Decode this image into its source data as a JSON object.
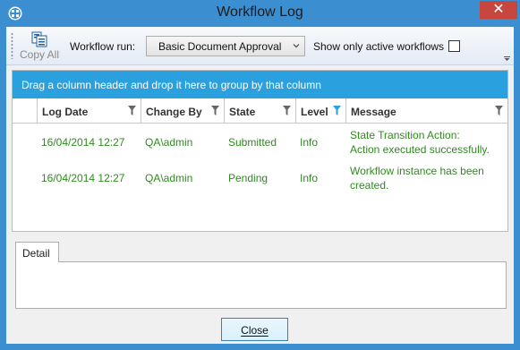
{
  "window": {
    "title": "Workflow Log",
    "close_glyph": "✕"
  },
  "toolbar": {
    "copy_all_label": "Copy All",
    "workflow_run_label": "Workflow run:",
    "workflow_run_value": "Basic Document Approval",
    "active_only_label": "Show only active workflows",
    "active_only_checked": false
  },
  "grid": {
    "group_hint": "Drag a column header and drop it here to group by that column",
    "columns": [
      {
        "label": "Log Date",
        "filter_active": false
      },
      {
        "label": "Change By",
        "filter_active": false
      },
      {
        "label": "State",
        "filter_active": false
      },
      {
        "label": "Level",
        "filter_active": true
      },
      {
        "label": "Message",
        "filter_active": false
      }
    ],
    "rows": [
      {
        "log_date": "16/04/2014 12:27",
        "change_by": "QA\\admin",
        "state": "Submitted",
        "level": "Info",
        "message_line1": "State Transition Action:",
        "message_line2": "Action executed successfully."
      },
      {
        "log_date": "16/04/2014 12:27",
        "change_by": "QA\\admin",
        "state": "Pending",
        "level": "Info",
        "message_line1": "Workflow instance has been",
        "message_line2": "created."
      }
    ]
  },
  "detail": {
    "tab_label": "Detail"
  },
  "footer": {
    "close_label": "Close"
  },
  "colors": {
    "title_bar": "#3b8fd0",
    "group_panel": "#2aa0de",
    "row_text": "#2e8b1e",
    "close_x_bg": "#c7463d",
    "active_filter": "#2aa0de"
  }
}
